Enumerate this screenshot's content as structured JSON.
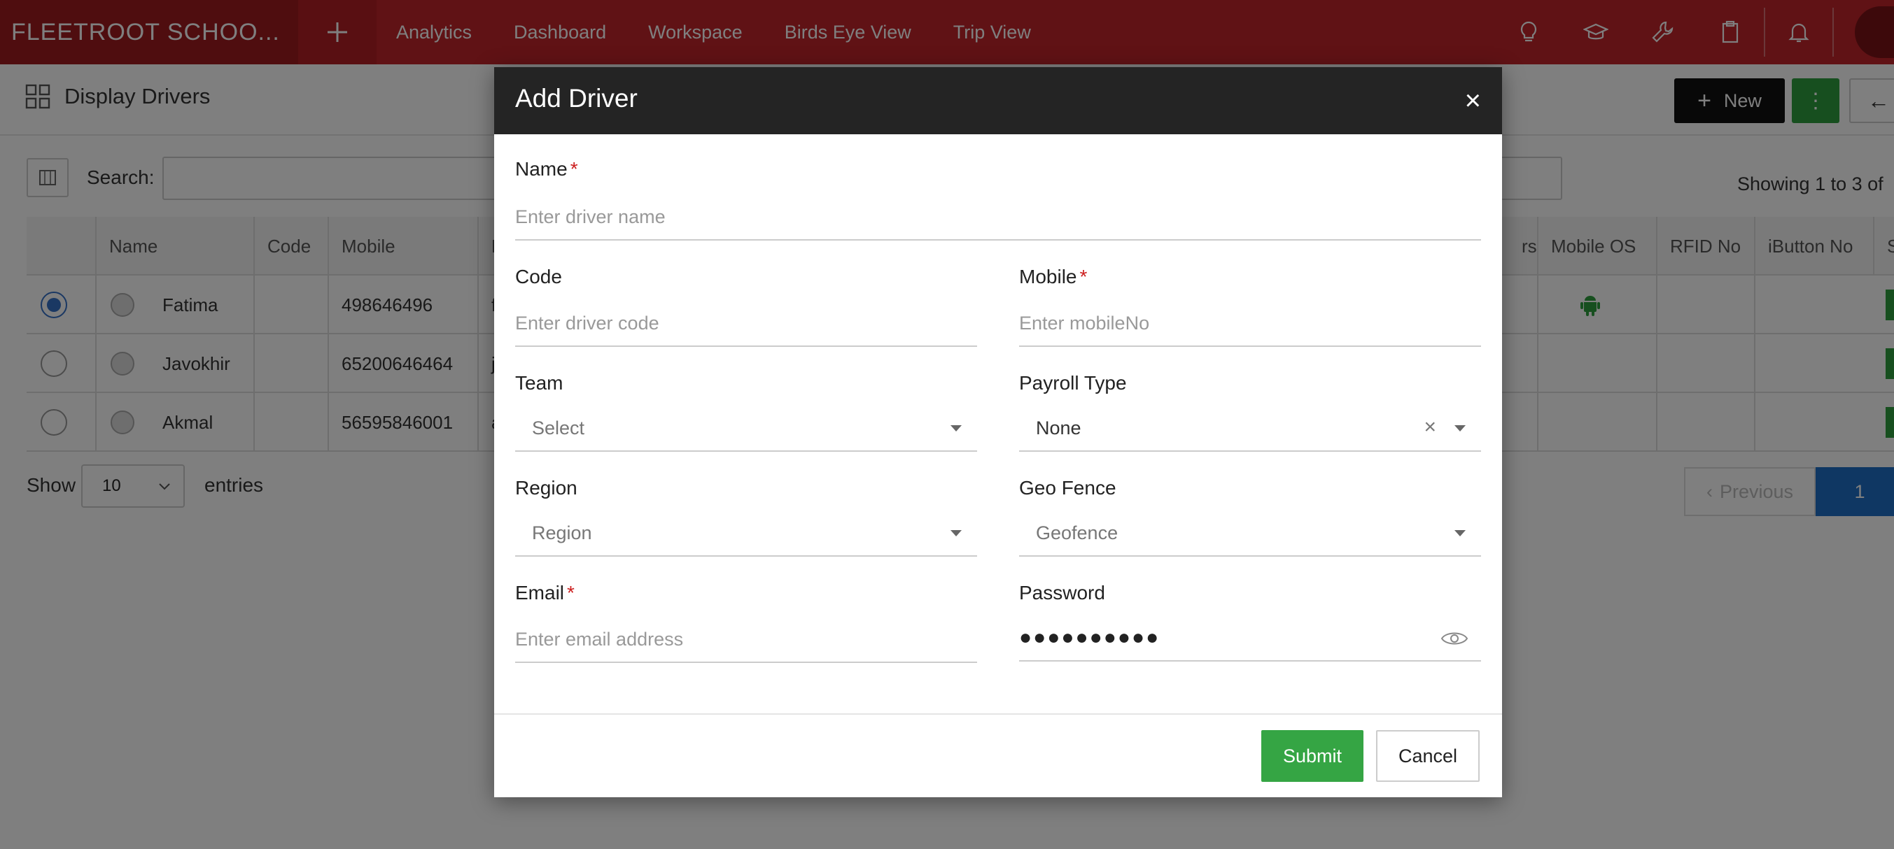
{
  "topbar": {
    "brand": "FLEETROOT SCHOO...",
    "nav": [
      "Analytics",
      "Dashboard",
      "Workspace",
      "Birds Eye View",
      "Trip View"
    ],
    "icons": [
      "lightbulb-icon",
      "graduation-cap-icon",
      "wrench-icon",
      "clipboard-icon",
      "bell-icon"
    ],
    "color": "#c0252b"
  },
  "page": {
    "title": "Display Drivers",
    "new_label": "New",
    "more_label": "⋮",
    "back_label": "←"
  },
  "toolbar": {
    "search_label": "Search:",
    "showing": "Showing 1 to 3 of"
  },
  "table": {
    "headers": {
      "name": "Name",
      "code": "Code",
      "mobile": "Mobile",
      "email_partial": "E",
      "users_partial": "rs",
      "mobile_os": "Mobile OS",
      "rfid": "RFID No",
      "ibutton": "iButton No",
      "status_partial": "S"
    },
    "rows": [
      {
        "name": "Fatima",
        "mobile": "498646496",
        "email_partial": "f",
        "selected": true,
        "android": true
      },
      {
        "name": "Javokhir",
        "mobile": "65200646464",
        "email_partial": "j",
        "selected": false,
        "android": false
      },
      {
        "name": "Akmal",
        "mobile": "56595846001",
        "email_partial": "a",
        "selected": false,
        "android": false
      }
    ]
  },
  "footer": {
    "show_label": "Show",
    "page_size": "10",
    "entries_label": "entries",
    "previous_label": "Previous",
    "current_page": "1"
  },
  "modal": {
    "title": "Add Driver",
    "close": "×",
    "name_label": "Name",
    "name_placeholder": "Enter driver name",
    "code_label": "Code",
    "code_placeholder": "Enter driver code",
    "mobile_label": "Mobile",
    "mobile_placeholder": "Enter mobileNo",
    "team_label": "Team",
    "team_value": "Select",
    "payroll_label": "Payroll Type",
    "payroll_value": "None",
    "region_label": "Region",
    "region_value": "Region",
    "geofence_label": "Geo Fence",
    "geofence_value": "Geofence",
    "email_label": "Email",
    "email_placeholder": "Enter email address",
    "password_label": "Password",
    "password_value": "●●●●●●●●●●",
    "required_mark": "*",
    "submit_label": "Submit",
    "cancel_label": "Cancel"
  }
}
